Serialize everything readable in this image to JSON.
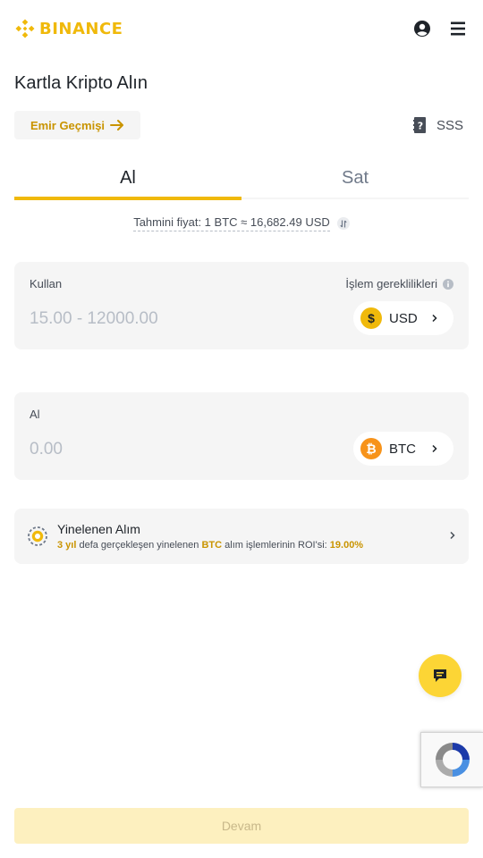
{
  "header": {
    "logo_text": "BINANCE",
    "brand_color": "#F0B90B",
    "icons": [
      "account-icon",
      "menu-icon"
    ]
  },
  "page": {
    "title": "Kartla Kripto Alın"
  },
  "actions": {
    "history_label": "Emir Geçmişi",
    "faq_label": "SSS"
  },
  "tabs": [
    {
      "label": "Al",
      "active": true
    },
    {
      "label": "Sat",
      "active": false
    }
  ],
  "rate": {
    "text": "Tahmini fiyat: 1 BTC ≈ 16,682.49 USD"
  },
  "spend": {
    "label": "Kullan",
    "requirements_label": "İşlem gereklilikleri",
    "placeholder": "15.00 - 12000.00",
    "value": "",
    "currency": "USD",
    "currency_symbol": "$"
  },
  "receive": {
    "label": "Al",
    "placeholder": "0.00",
    "value": "",
    "currency": "BTC",
    "currency_symbol": "₿"
  },
  "recurring": {
    "title": "Yinelenen Alım",
    "period": "3 yıl",
    "text_1": "defa gerçekleşen yinelenen",
    "asset": "BTC",
    "text_2": "alım işlemlerinin ROI'si:",
    "roi": "19.00%"
  },
  "footer": {
    "continue_label": "Devam",
    "continue_enabled": false
  },
  "colors": {
    "accent": "#F0B90B",
    "accent_text": "#C99400",
    "surface": "#F5F5F5",
    "disabled_button": "#FDF0BF"
  }
}
